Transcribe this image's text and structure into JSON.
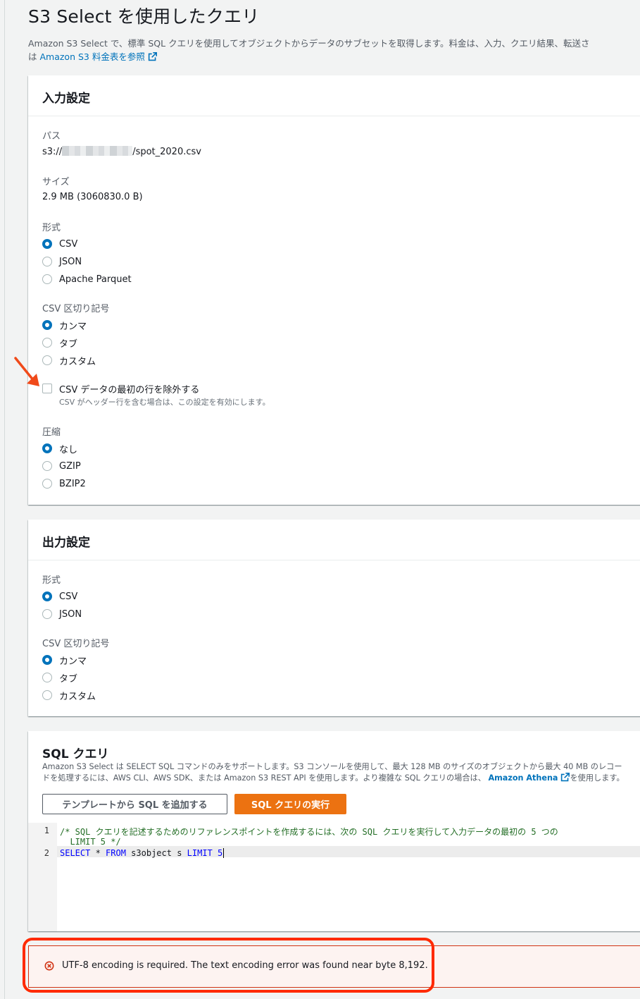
{
  "page": {
    "title": "S3 Select を使用したクエリ",
    "description_line1": "Amazon S3 Select で、標準 SQL クエリを使用してオブジェクトからデータのサブセットを取得します。料金は、入力、クエリ結果、転送さ",
    "description_prefix": "は ",
    "pricing_link": "Amazon S3 料金表を参照"
  },
  "input_settings": {
    "header": "入力設定",
    "path_label": "パス",
    "path_prefix": "s3://",
    "path_suffix": "/spot_2020.csv",
    "size_label": "サイズ",
    "size_value": "2.9 MB (3060830.0 B)",
    "format_label": "形式",
    "format_options": [
      "CSV",
      "JSON",
      "Apache Parquet"
    ],
    "format_selected": "CSV",
    "delimiter_label": "CSV 区切り記号",
    "delimiter_options": [
      "カンマ",
      "タブ",
      "カスタム"
    ],
    "delimiter_selected": "カンマ",
    "exclude_header_label": "CSV データの最初の行を除外する",
    "exclude_header_desc": "CSV がヘッダー行を含む場合は、この設定を有効にします。",
    "exclude_header_checked": false,
    "compression_label": "圧縮",
    "compression_options": [
      "なし",
      "GZIP",
      "BZIP2"
    ],
    "compression_selected": "なし"
  },
  "output_settings": {
    "header": "出力設定",
    "format_label": "形式",
    "format_options": [
      "CSV",
      "JSON"
    ],
    "format_selected": "CSV",
    "delimiter_label": "CSV 区切り記号",
    "delimiter_options": [
      "カンマ",
      "タブ",
      "カスタム"
    ],
    "delimiter_selected": "カンマ"
  },
  "sql_query": {
    "header": "SQL クエリ",
    "desc_line1": "Amazon S3 Select は SELECT SQL コマンドのみをサポートします。S3 コンソールを使用して、最大 128 MB のサイズのオブジェクトから最大 40 MB のレコー",
    "desc_line2_prefix": "ドを処理するには、AWS CLI、AWS SDK、または Amazon S3 REST API を使用します。より複雑な SQL クエリの場合は、",
    "athena_link": "Amazon Athena",
    "desc_line2_suffix": "を使用します。",
    "add_template_button": "テンプレートから SQL を追加する",
    "run_button": "SQL クエリの実行",
    "editor": {
      "line_numbers": [
        "1",
        "2"
      ],
      "line1_comment": "/* SQL クエリを記述するためのリファレンスポイントを作成するには、次の SQL クエリを実行して入力データの最初の 5 つの",
      "line1_wrap": "  LIMIT 5 */",
      "line2_kw_select": "SELECT",
      "line2_star": " * ",
      "line2_kw_from": "FROM",
      "line2_ident": " s3object s ",
      "line2_kw_limit": "LIMIT",
      "line2_number": " 5"
    }
  },
  "error": {
    "message": "UTF-8 encoding is required. The text encoding error was found near byte 8,192."
  },
  "colors": {
    "accent": "#0073bb",
    "primary_button": "#ec7211",
    "error": "#d13212",
    "annotation": "#ff2a00"
  }
}
